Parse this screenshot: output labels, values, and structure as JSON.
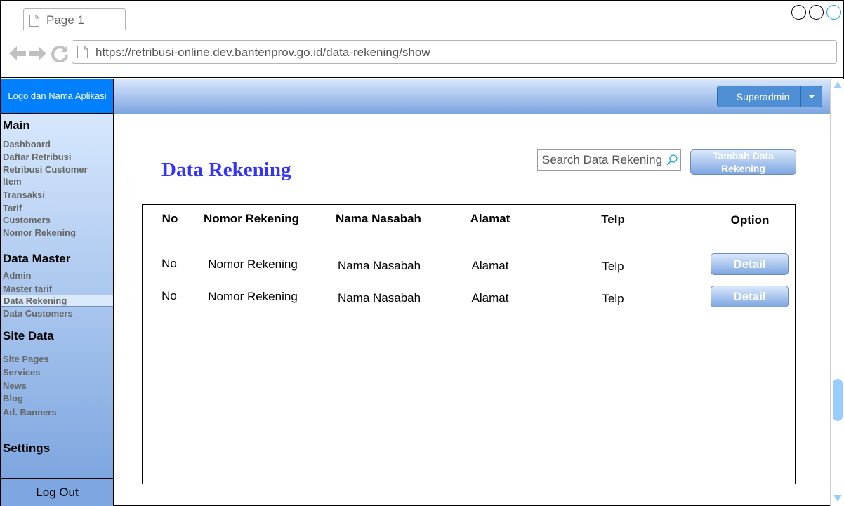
{
  "browser": {
    "tab_label": "Page 1",
    "url": "https://retribusi-online.dev.bantenprov.go.id/data-rekening/show"
  },
  "app": {
    "logo_text": "Logo dan Nama Aplikasi",
    "user_label": "Superadmin",
    "logout_label": "Log Out"
  },
  "sidebar": {
    "main_heading": "Main",
    "main_items": [
      "Dashboard",
      "Daftar Retribusi",
      "Retribusi Customer",
      "Item",
      "Transaksi",
      "Tarif",
      "Customers",
      "Nomor Rekening"
    ],
    "master_heading": "Data Master",
    "master_items": [
      "Admin",
      "Master tarif",
      "Data Rekening",
      "Data Customers"
    ],
    "site_heading": "Site Data",
    "site_items": [
      "Site Pages",
      "Services",
      "News",
      "Blog",
      "Ad. Banners"
    ],
    "settings_heading": "Settings",
    "active_item": "Data Rekening"
  },
  "main": {
    "title": "Data Rekening",
    "search_placeholder": "Search Data Rekening",
    "add_button": "Tambah Data Rekening",
    "columns": [
      "No",
      "Nomor Rekening",
      "Nama Nasabah",
      "Alamat",
      "Telp",
      "Option"
    ],
    "rows": [
      {
        "no": "No",
        "nomor_rekening": "Nomor Rekening",
        "nama_nasabah": "Nama Nasabah",
        "alamat": "Alamat",
        "telp": "Telp",
        "action": "Detail"
      },
      {
        "no": "No",
        "nomor_rekening": "Nomor Rekening",
        "nama_nasabah": "Nama Nasabah",
        "alamat": "Alamat",
        "telp": "Telp",
        "action": "Detail"
      }
    ]
  },
  "colors": {
    "logo_bg": "#007fff",
    "title": "#3333ff",
    "button_top": "#dae8fc",
    "button_bottom": "#7ea6e0",
    "user_button": "#4e8fd6"
  }
}
